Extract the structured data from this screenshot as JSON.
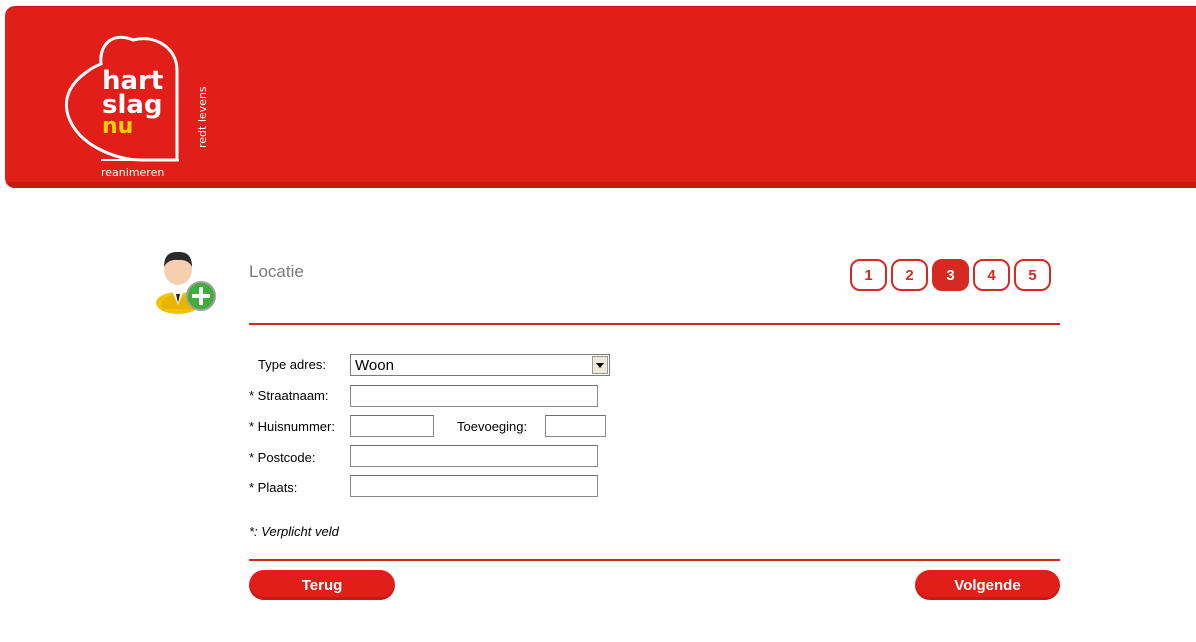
{
  "brand": {
    "line1": "hart",
    "line2": "slag",
    "line3": "nu",
    "tagline": "redt levens",
    "sub": "reanimeren"
  },
  "page": {
    "title": "Locatie"
  },
  "steps": [
    "1",
    "2",
    "3",
    "4",
    "5"
  ],
  "active_step": 3,
  "form": {
    "type_label": "Type adres:",
    "type_value": "Woon",
    "street_label": "* Straatnaam:",
    "street_value": "",
    "house_label": "* Huisnummer:",
    "house_value": "",
    "addition_label": "Toevoeging:",
    "addition_value": "",
    "postcode_label": "* Postcode:",
    "postcode_value": "",
    "city_label": "* Plaats:",
    "city_value": ""
  },
  "note": "*: Verplicht veld",
  "buttons": {
    "back": "Terug",
    "next": "Volgende"
  },
  "colors": {
    "brand_red": "#e21e18",
    "accent_yellow": "#fbd000"
  }
}
